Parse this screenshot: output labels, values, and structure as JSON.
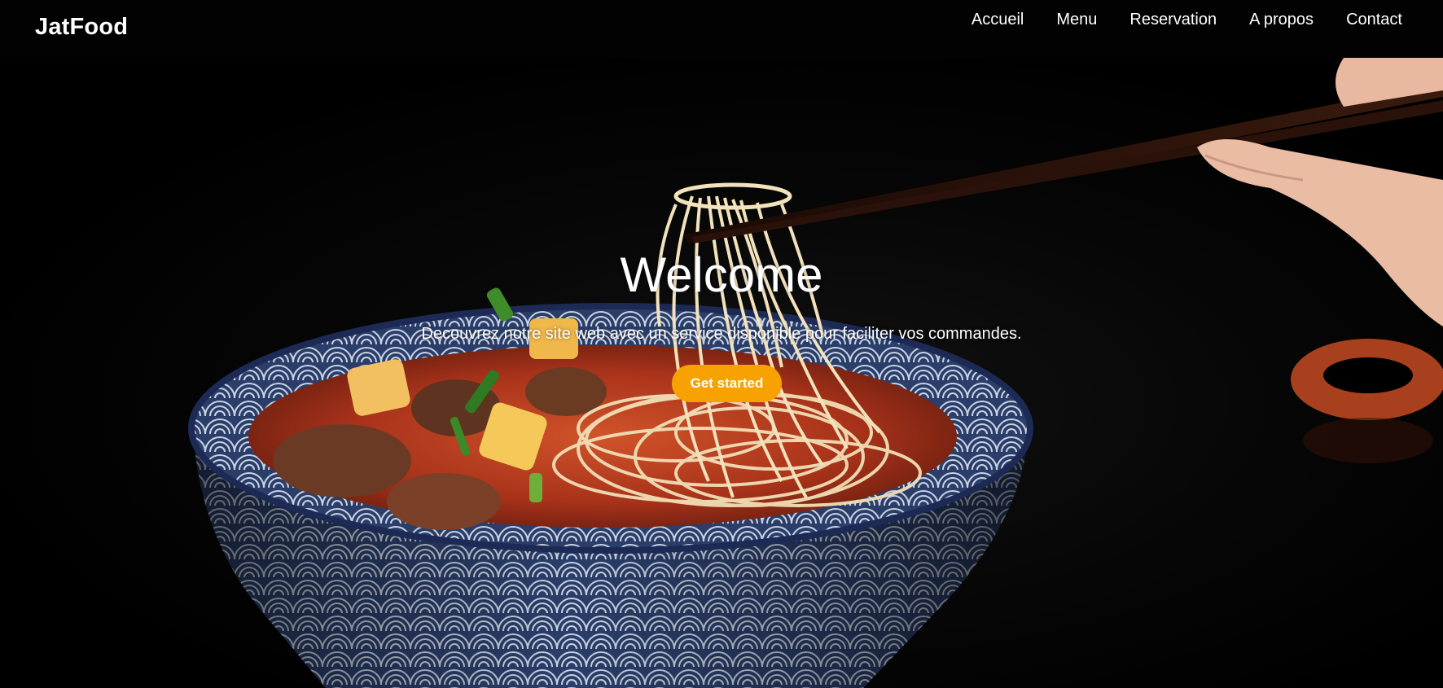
{
  "brand": {
    "name": "JatFood"
  },
  "nav": {
    "items": [
      {
        "label": "Accueil"
      },
      {
        "label": "Menu"
      },
      {
        "label": "Reservation"
      },
      {
        "label": "A propos"
      },
      {
        "label": "Contact"
      }
    ]
  },
  "hero": {
    "title": "Welcome",
    "subtitle": "Decouvrez notre site web avec un service disponible pour faciliter vos commandes.",
    "cta_label": "Get started",
    "background_image": "noodle-bowl-chopsticks-photo"
  },
  "colors": {
    "nav_background": "#020202",
    "accent": "#f7a200",
    "text": "#ffffff"
  }
}
